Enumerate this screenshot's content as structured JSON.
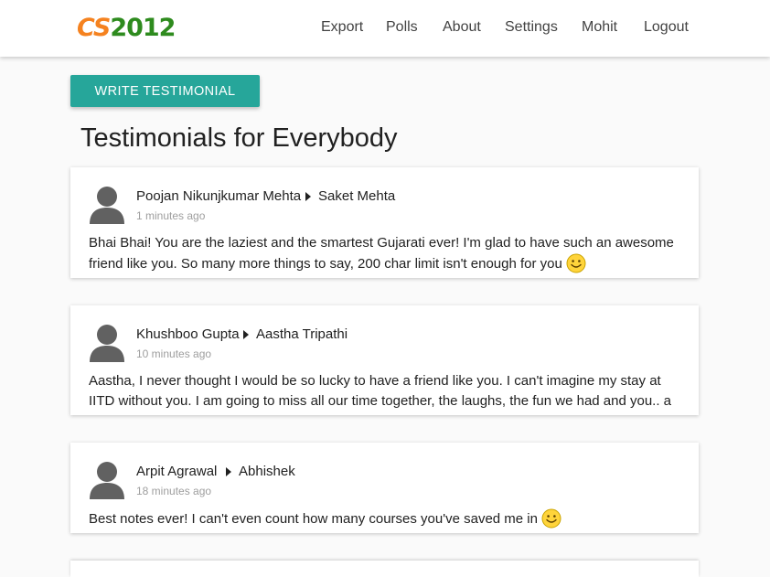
{
  "brand": {
    "cs": "CS",
    "year": "2012"
  },
  "nav": {
    "export": "Export",
    "polls": "Polls",
    "about": "About",
    "settings": "Settings",
    "user": "Mohit",
    "logout": "Logout"
  },
  "write_button": "WRITE TESTIMONIAL",
  "page_title": "Testimonials for Everybody",
  "colors": {
    "accent": "#26a69a",
    "logo_orange": "#f5821f",
    "logo_green": "#2e8b1e"
  },
  "testimonials": [
    {
      "from": "Poojan Nikunjkumar Mehta",
      "to": "Saket Mehta",
      "time": "1 minutes ago",
      "message": "Bhai Bhai! You are the laziest and the smartest Gujarati ever! I'm glad to have such an awesome friend like you. So many more things to say, 200 char limit isn't enough for you",
      "emoji": "smiley-icon"
    },
    {
      "from": "Khushboo Gupta",
      "to": "Aastha Tripathi",
      "time": "10 minutes ago",
      "message": "Aastha, I never thought I would be so lucky to have a friend like you. I can't imagine my stay at IITD without you. I am going to miss all our time together, the laughs, the fun we had and you.. a lot"
    },
    {
      "from": "Arpit Agrawal",
      "to": "Abhishek",
      "time": "18 minutes ago",
      "message": "Best notes ever! I can't even count how many courses you've saved me in",
      "emoji": "smiley-icon"
    }
  ]
}
